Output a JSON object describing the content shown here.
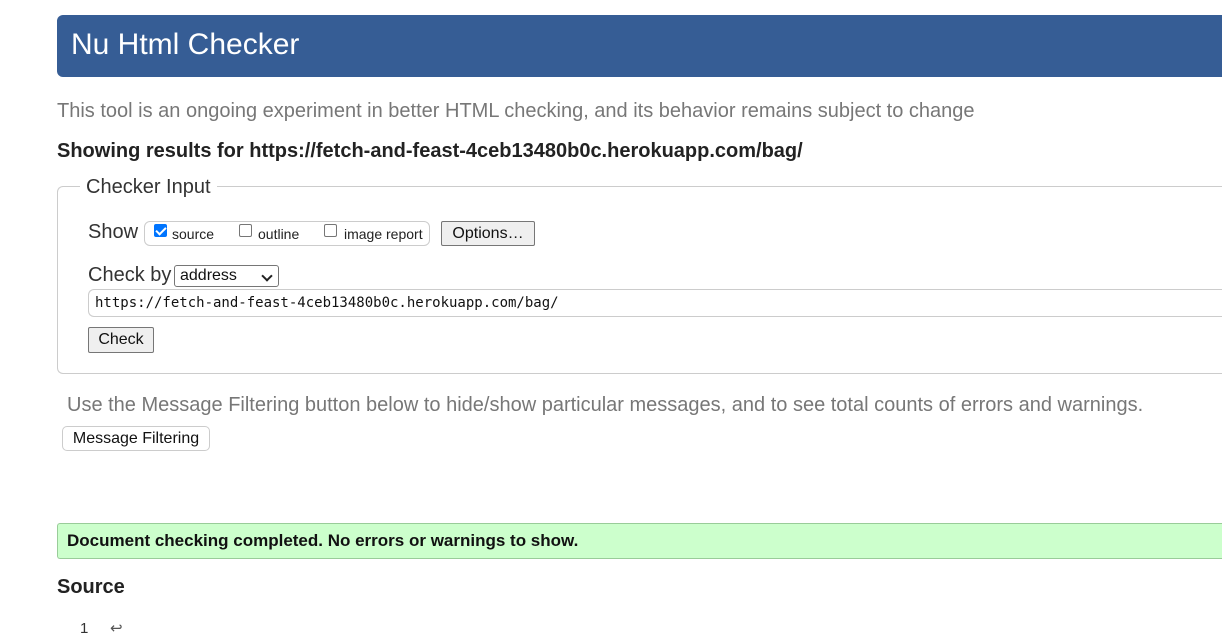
{
  "header": {
    "title": "Nu Html Checker"
  },
  "intro": "This tool is an ongoing experiment in better HTML checking, and its behavior remains subject to change",
  "results_for": "Showing results for https://fetch-and-feast-4ceb13480b0c.herokuapp.com/bag/",
  "checker_input": {
    "legend": "Checker Input",
    "show_label": "Show",
    "show_options": [
      {
        "label": "source",
        "checked": true
      },
      {
        "label": "outline",
        "checked": false
      },
      {
        "label": "image report",
        "checked": false
      }
    ],
    "options_button": "Options…",
    "check_by_label": "Check by",
    "check_by_value": "address",
    "url_value": "https://fetch-and-feast-4ceb13480b0c.herokuapp.com/bag/",
    "check_button": "Check"
  },
  "filtering": {
    "hint": "Use the Message Filtering button below to hide/show particular messages, and to see total counts of errors and warnings.",
    "button": "Message Filtering"
  },
  "status": {
    "message": "Document checking completed. No errors or warnings to show.",
    "color": "#ccffcc"
  },
  "source": {
    "heading": "Source",
    "lines": [
      {
        "number": "1",
        "icon": "return-icon",
        "glyph": "↩"
      }
    ]
  }
}
